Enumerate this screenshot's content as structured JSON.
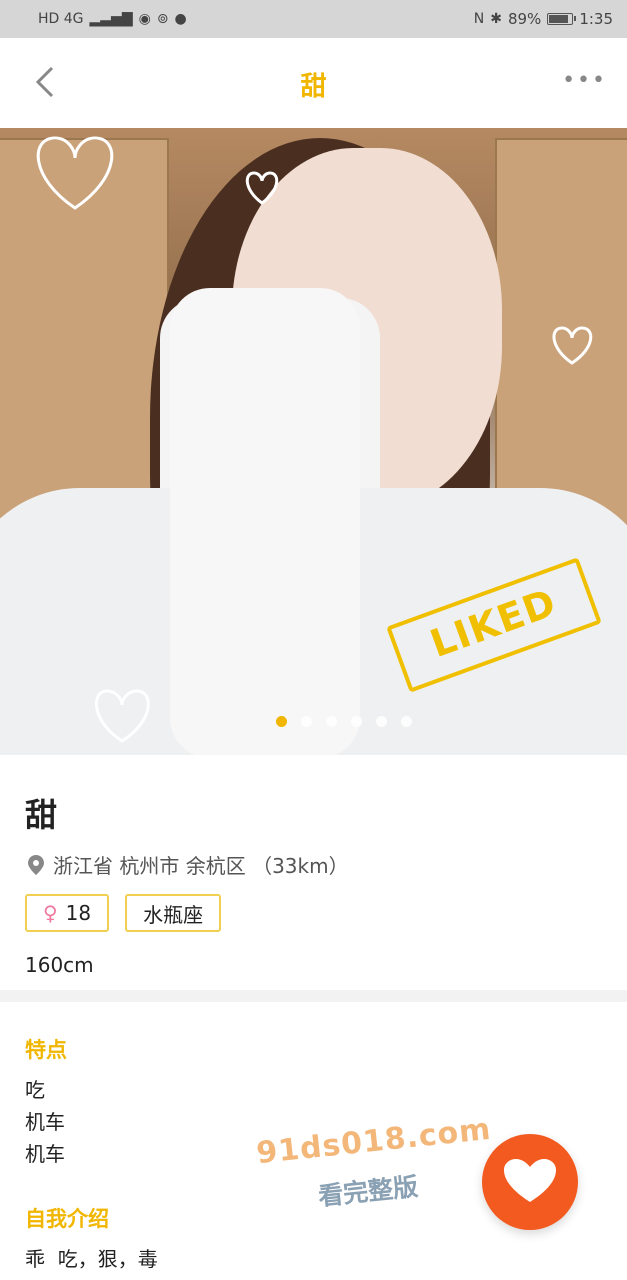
{
  "status_bar": {
    "network": "HD 4G",
    "nfc": "N",
    "battery_pct": "89%",
    "time": "1:35"
  },
  "header": {
    "title": "甜",
    "more": "•••"
  },
  "photo": {
    "stamp": "LIKED",
    "page_count": 6,
    "active_index": 0
  },
  "profile": {
    "name": "甜",
    "location": "浙江省 杭州市 余杭区 （33km）",
    "gender_symbol": "♀",
    "age": "18",
    "zodiac": "水瓶座",
    "height": "160cm"
  },
  "traits": {
    "title": "特点",
    "items": [
      "吃",
      "机车",
      "机车"
    ]
  },
  "intro": {
    "title": "自我介绍",
    "text": "乖  吃，狠，毒"
  },
  "watermark": {
    "line1": "91ds018.com",
    "line2": "看完整版"
  },
  "colors": {
    "accent": "#f1b600",
    "like_button": "#f25a1f"
  }
}
